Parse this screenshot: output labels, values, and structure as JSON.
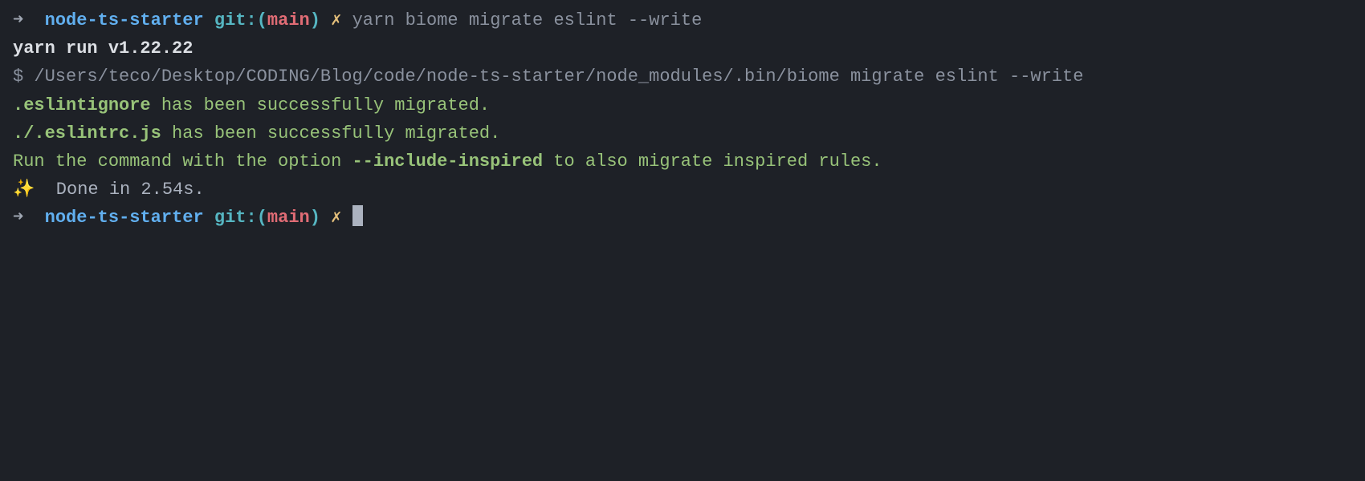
{
  "prompt1": {
    "arrow": "➜  ",
    "dir": "node-ts-starter",
    "git_label": " git:",
    "git_open": "(",
    "git_branch": "main",
    "git_close": ")",
    "dirty": " ✗ ",
    "cmd_yarn": "yarn",
    "cmd_rest": " biome migrate eslint --write"
  },
  "yarn_run": "yarn run v1.22.22",
  "shell_line": "$ /Users/teco/Desktop/CODING/Blog/code/node-ts-starter/node_modules/.bin/biome migrate eslint --write",
  "migrate1": {
    "file": ".eslintignore",
    "msg": " has been successfully migrated."
  },
  "migrate2": {
    "file": "./.eslintrc.js",
    "msg": " has been successfully migrated."
  },
  "hint": {
    "pre": "Run the command with the option ",
    "flag": "--include-inspired",
    "post": " to also migrate inspired rules."
  },
  "done": {
    "sparkle": "✨",
    "text": "  Done in 2.54s."
  },
  "prompt2": {
    "arrow": "➜  ",
    "dir": "node-ts-starter",
    "git_label": " git:",
    "git_open": "(",
    "git_branch": "main",
    "git_close": ")",
    "dirty": " ✗ "
  }
}
